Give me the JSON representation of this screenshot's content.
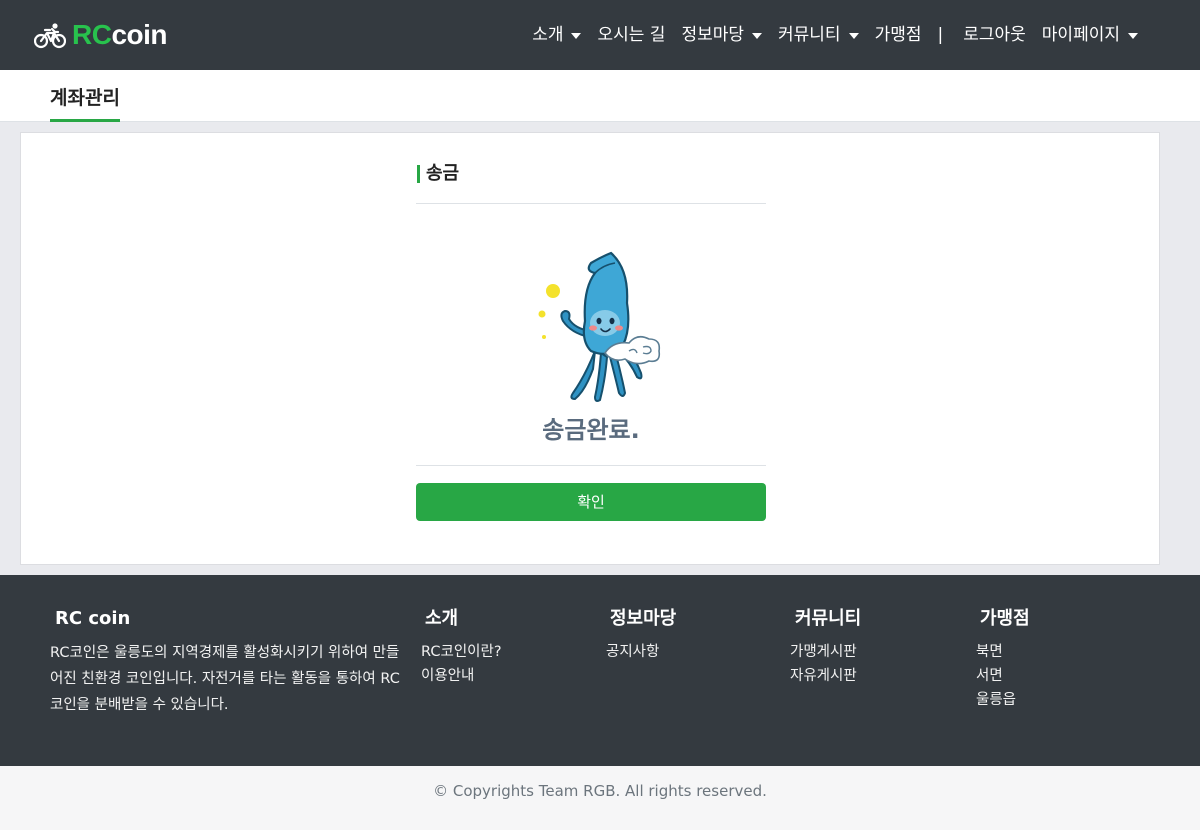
{
  "brand": {
    "rc": "RC",
    "coin": "coin",
    "logo_icon": "bicycle-icon",
    "accent_color": "#28c24d"
  },
  "nav": {
    "items": [
      {
        "label": "소개",
        "dropdown": true
      },
      {
        "label": "오시는 길",
        "dropdown": false
      },
      {
        "label": "정보마당",
        "dropdown": true
      },
      {
        "label": "커뮤니티",
        "dropdown": true
      },
      {
        "label": "가맹점",
        "dropdown": false
      }
    ],
    "separator": "|",
    "logout": "로그아웃",
    "mypage": "마이페이지"
  },
  "subnav": {
    "tab": "계좌관리"
  },
  "main": {
    "section_title": "송금",
    "mascot_icon": "squid-mascot-icon",
    "message": "송금완료.",
    "confirm_label": "확인"
  },
  "footer": {
    "about": {
      "title": "RC coin",
      "text": "RC코인은 울릉도의 지역경제를 활성화시키기 위하여 만들어진 친환경 코인입니다. 자전거를 타는 활동을 통하여 RC코인을 분배받을 수 있습니다."
    },
    "intro": {
      "title": "소개",
      "links": [
        "RC코인이란?",
        "이용안내"
      ]
    },
    "info": {
      "title": "정보마당",
      "links": [
        "공지사항"
      ]
    },
    "community": {
      "title": "커뮤니티",
      "links": [
        "가맹게시판",
        "자유게시판"
      ]
    },
    "stores": {
      "title": "가맹점",
      "links": [
        "북면",
        "서면",
        "울릉읍"
      ]
    }
  },
  "copyright": "© Copyrights Team RGB. All rights reserved.",
  "colors": {
    "header_bg": "#343a40",
    "accent": "#28a745",
    "page_bg": "#e9eaee"
  }
}
